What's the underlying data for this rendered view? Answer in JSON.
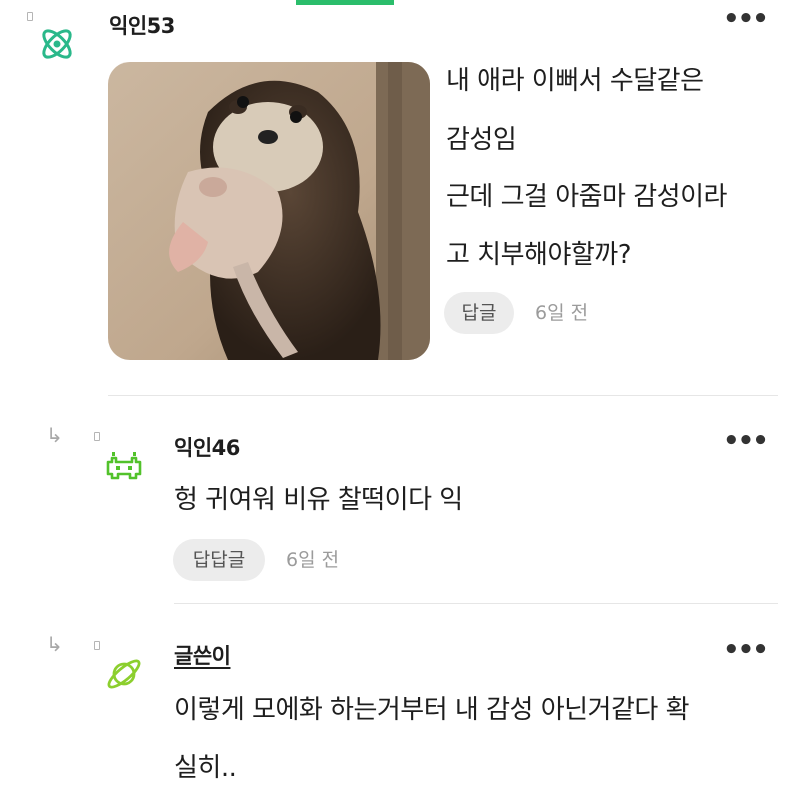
{
  "comments": [
    {
      "nickname": "익인53",
      "avatar_icon": "atom-icon",
      "avatar_color": "#2ab88a",
      "image_alt": "otter-holding-pup-photo",
      "lines": [
        "내 애라 이뻐서 수달같은",
        "감성임",
        "근데 그걸 아줌마 감성이라",
        "고 치부해야할까?"
      ],
      "reply_label": "답글",
      "time": "6일 전"
    },
    {
      "nickname": "익인46",
      "avatar_icon": "space-invader-icon",
      "avatar_color": "#52c22b",
      "lines": [
        "헝 귀여워 비유 찰떡이다 익"
      ],
      "reply_label": "답답글",
      "time": "6일 전"
    },
    {
      "nickname": "글쓴이",
      "avatar_icon": "planet-icon",
      "avatar_color": "#8ccf2e",
      "lines": [
        "이렇게 모에화 하는거부터 내 감성 아닌거같다 확",
        "실히.."
      ]
    }
  ],
  "more_label": "•••"
}
